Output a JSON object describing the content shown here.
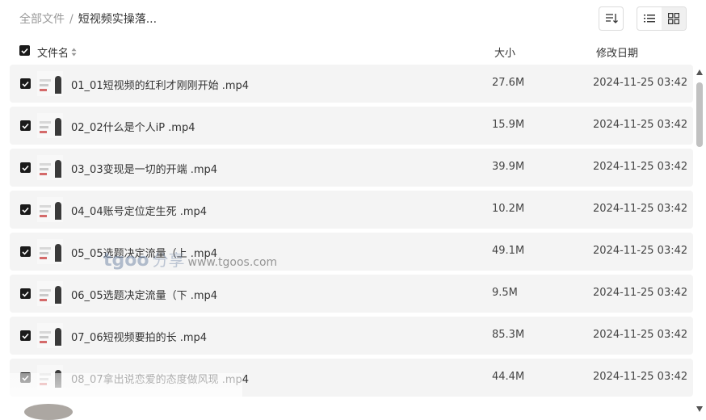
{
  "breadcrumb": {
    "root": "全部文件",
    "separator": "/",
    "current": "短视频实操落..."
  },
  "toolbar": {
    "sort_icon": "sort-icon",
    "list_view_icon": "list-view-icon",
    "grid_view_icon": "grid-view-icon",
    "active_view": "grid"
  },
  "table": {
    "headers": {
      "name": "文件名",
      "size": "大小",
      "date": "修改日期"
    },
    "rows": [
      {
        "name": "01_01短视频的红利才刚刚开始 .mp4",
        "size": "27.6M",
        "date": "2024-11-25 03:42",
        "checked": true
      },
      {
        "name": "02_02什么是个人iP .mp4",
        "size": "15.9M",
        "date": "2024-11-25 03:42",
        "checked": true
      },
      {
        "name": "03_03变现是一切的开端 .mp4",
        "size": "39.9M",
        "date": "2024-11-25 03:42",
        "checked": true
      },
      {
        "name": "04_04账号定位定生死 .mp4",
        "size": "10.2M",
        "date": "2024-11-25 03:42",
        "checked": true
      },
      {
        "name": "05_05选题决定流量（上 .mp4",
        "size": "49.1M",
        "date": "2024-11-25 03:42",
        "checked": true
      },
      {
        "name": "06_05选题决定流量（下 .mp4",
        "size": "9.5M",
        "date": "2024-11-25 03:42",
        "checked": true
      },
      {
        "name": "07_06短视频要拍的长 .mp4",
        "size": "85.3M",
        "date": "2024-11-25 03:42",
        "checked": true
      },
      {
        "name": "08_07拿出说恋爱的态度做风现 .mp4",
        "size": "44.4M",
        "date": "2024-11-25 03:42",
        "checked": true
      }
    ]
  },
  "watermark": {
    "logo": "tgoo",
    "cn": "分享",
    "url": "www.tgoos.com"
  },
  "colors": {
    "row_bg": "#f4f4f4",
    "checkbox": "#1a1a1a",
    "text": "#333333",
    "muted": "#999999"
  }
}
